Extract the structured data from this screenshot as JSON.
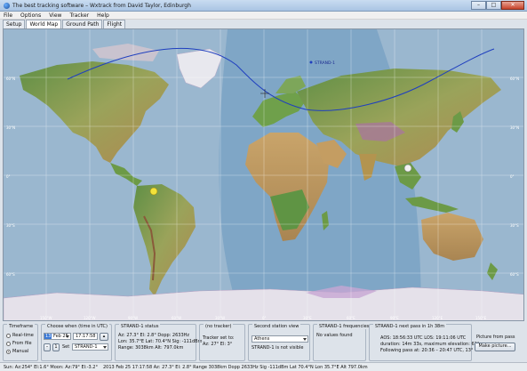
{
  "window": {
    "title": "The best tracking software – Wxtrack from David Taylor, Edinburgh",
    "minimize_glyph": "–",
    "maximize_glyph": "□",
    "close_glyph": "✕"
  },
  "menu": {
    "file": "File",
    "options": "Options",
    "view": "View",
    "tracker": "Tracker",
    "help": "Help"
  },
  "tabs": {
    "setup": "Setup",
    "world_map": "World Map",
    "ground_path": "Ground Path",
    "flight": "Flight"
  },
  "map": {
    "satellite_label": "STRAND-1",
    "lat_labels": {
      "n60": "60°N",
      "n30": "30°N",
      "eq": "0°",
      "s30": "30°S",
      "s60": "60°S"
    },
    "lon_labels": {
      "w150": "150°W",
      "w120": "120°W",
      "w90": "90°W",
      "w60": "60°W",
      "w30": "30°W",
      "e0": "0°",
      "e30": "30°E",
      "e60": "60°E",
      "e90": "90°E",
      "e120": "120°E",
      "e150": "150°E"
    }
  },
  "timeframe": {
    "label": "Timeframe",
    "realtime": "Real-time",
    "from_file": "From file",
    "manual": "Manual"
  },
  "choose_when": {
    "label": "Choose when (time in UTC)",
    "day": "13",
    "month": "Feb 25",
    "time": "17:17:58",
    "step_minus": "–",
    "step_plus": "1",
    "set_label": "Set",
    "sat_select": "STRAND-1"
  },
  "strand_status": {
    "label": "STRAND-1 status",
    "line1": "Az: 27.3°  El: 2.8°  Dopp: 2633Hz",
    "line2": "Lon: 35.7°E  Lat: 70.4°N  Sig: -111dBm",
    "line3": "Range: 3038km  Alt: 797.0km"
  },
  "no_tracker": {
    "label": "(no tracker)",
    "line1": "Tracker set to:",
    "line2": "Az: 27°  El: 3°"
  },
  "second_station": {
    "label": "Second station view",
    "select": "Athens",
    "status": "STRAND-1 is not visible"
  },
  "frequencies": {
    "label": "STRAND-1 frequencies",
    "status": "No values found"
  },
  "next_pass": {
    "label": "STRAND-1 next pass in 1h 38m",
    "line1": "AOS: 18:56:33 UTC  LOS: 19:11:06 UTC",
    "line2": "duration: 14m 33s,  maximum elevation: 62°",
    "line3": "Following pass at: 20:36 – 20:47 UTC, 13°"
  },
  "picture": {
    "label": "Picture from pass",
    "button": "Make picture..."
  },
  "status_bar": {
    "sun_moon": "Sun: Az:254° El:1.6°   Moon: Az:79° El:-3.2°",
    "info": "2013 Feb 25  17:17:58   Az: 27.3°  El: 2.8°   Range 3038km   Dopp 2633Hz   Sig -111dBm   Lat 70.4°N   Lon 35.7°E   Alt 797.0km"
  },
  "colors": {
    "track": "#1f3fbf",
    "ocean": "#7fa6c6",
    "satellite_marker": "#f3e23a"
  }
}
